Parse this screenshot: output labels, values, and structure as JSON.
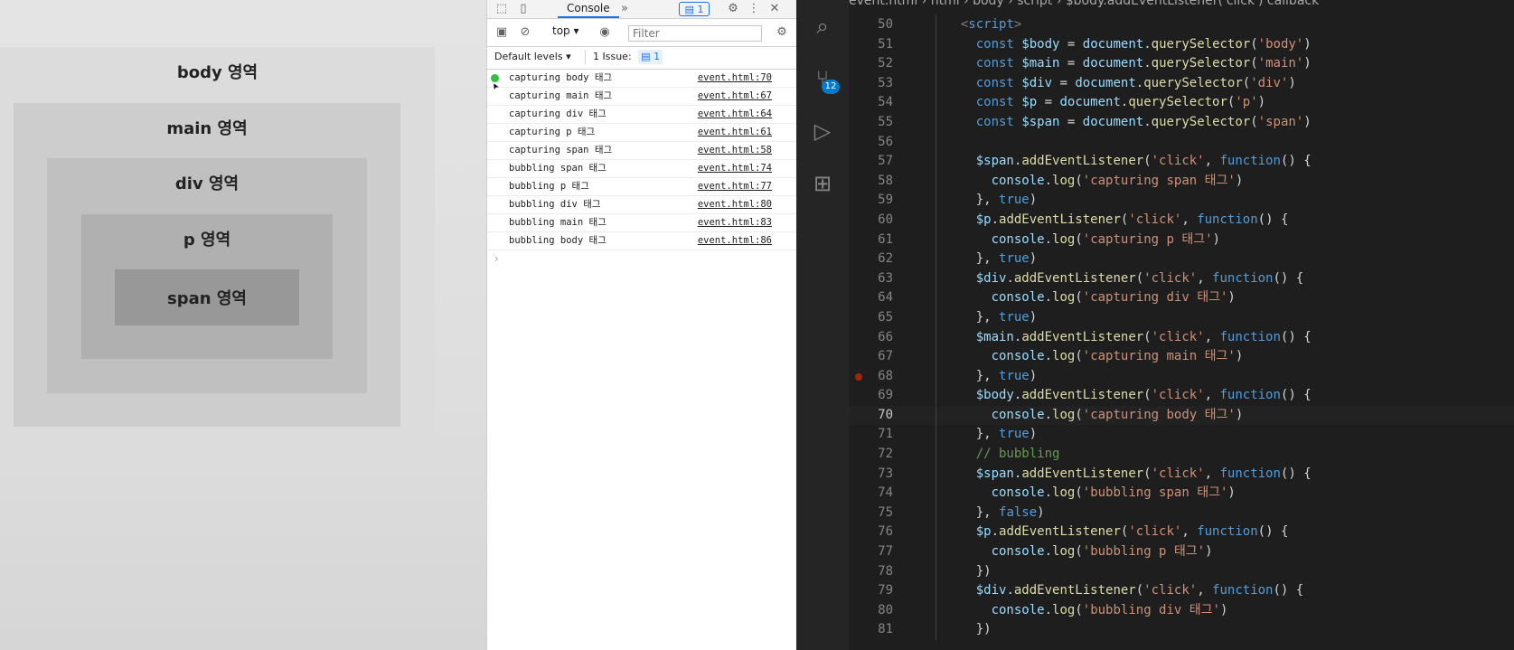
{
  "preview": {
    "labels": {
      "body": "body 영역",
      "main": "main 영역",
      "div": "div 영역",
      "p": "p 영역",
      "span": "span 영역"
    }
  },
  "devtools": {
    "active_tab": "Console",
    "message_count": "1",
    "context": "top",
    "filter_placeholder": "Filter",
    "levels": "Default levels",
    "issue_text": "1 Issue:",
    "issue_count": "1",
    "logs": [
      {
        "msg": "capturing body 태그",
        "src": "event.html:70"
      },
      {
        "msg": "capturing main 태그",
        "src": "event.html:67"
      },
      {
        "msg": "capturing div 태그",
        "src": "event.html:64"
      },
      {
        "msg": "capturing p 태그",
        "src": "event.html:61"
      },
      {
        "msg": "capturing span 태그",
        "src": "event.html:58"
      },
      {
        "msg": "bubbling span 태그",
        "src": "event.html:74"
      },
      {
        "msg": "bubbling p 태그",
        "src": "event.html:77"
      },
      {
        "msg": "bubbling div 태그",
        "src": "event.html:80"
      },
      {
        "msg": "bubbling main 태그",
        "src": "event.html:83"
      },
      {
        "msg": "bubbling body 태그",
        "src": "event.html:86"
      }
    ]
  },
  "vscode": {
    "scm_badge": "12",
    "breadcrumb": [
      "event.html",
      "html",
      "body",
      "script",
      "$body.addEventListener('click') callback"
    ],
    "lines": [
      {
        "n": "50",
        "text": "  <script>"
      },
      {
        "n": "51",
        "text": "    const $body = document.querySelector('body')"
      },
      {
        "n": "52",
        "text": "    const $main = document.querySelector('main')"
      },
      {
        "n": "53",
        "text": "    const $div = document.querySelector('div')"
      },
      {
        "n": "54",
        "text": "    const $p = document.querySelector('p')"
      },
      {
        "n": "55",
        "text": "    const $span = document.querySelector('span')"
      },
      {
        "n": "56",
        "text": ""
      },
      {
        "n": "57",
        "text": "    $span.addEventListener('click', function() {"
      },
      {
        "n": "58",
        "text": "      console.log('capturing span 태그')"
      },
      {
        "n": "59",
        "text": "    }, true)"
      },
      {
        "n": "60",
        "text": "    $p.addEventListener('click', function() {"
      },
      {
        "n": "61",
        "text": "      console.log('capturing p 태그')"
      },
      {
        "n": "62",
        "text": "    }, true)"
      },
      {
        "n": "63",
        "text": "    $div.addEventListener('click', function() {"
      },
      {
        "n": "64",
        "text": "      console.log('capturing div 태그')"
      },
      {
        "n": "65",
        "text": "    }, true)"
      },
      {
        "n": "66",
        "text": "    $main.addEventListener('click', function() {"
      },
      {
        "n": "67",
        "text": "      console.log('capturing main 태그')"
      },
      {
        "n": "68",
        "text": "    }, true)"
      },
      {
        "n": "69",
        "text": "    $body.addEventListener('click', function() {"
      },
      {
        "n": "70",
        "text": "      console.log('capturing body 태그')"
      },
      {
        "n": "71",
        "text": "    }, true)"
      },
      {
        "n": "72",
        "text": "    // bubbling"
      },
      {
        "n": "73",
        "text": "    $span.addEventListener('click', function() {"
      },
      {
        "n": "74",
        "text": "      console.log('bubbling span 태그')"
      },
      {
        "n": "75",
        "text": "    }, false)"
      },
      {
        "n": "76",
        "text": "    $p.addEventListener('click', function() {"
      },
      {
        "n": "77",
        "text": "      console.log('bubbling p 태그')"
      },
      {
        "n": "78",
        "text": "    })"
      },
      {
        "n": "79",
        "text": "    $div.addEventListener('click', function() {"
      },
      {
        "n": "80",
        "text": "      console.log('bubbling div 태그')"
      },
      {
        "n": "81",
        "text": "    })"
      }
    ],
    "current_line": "70",
    "breakpoint_line": "68"
  }
}
